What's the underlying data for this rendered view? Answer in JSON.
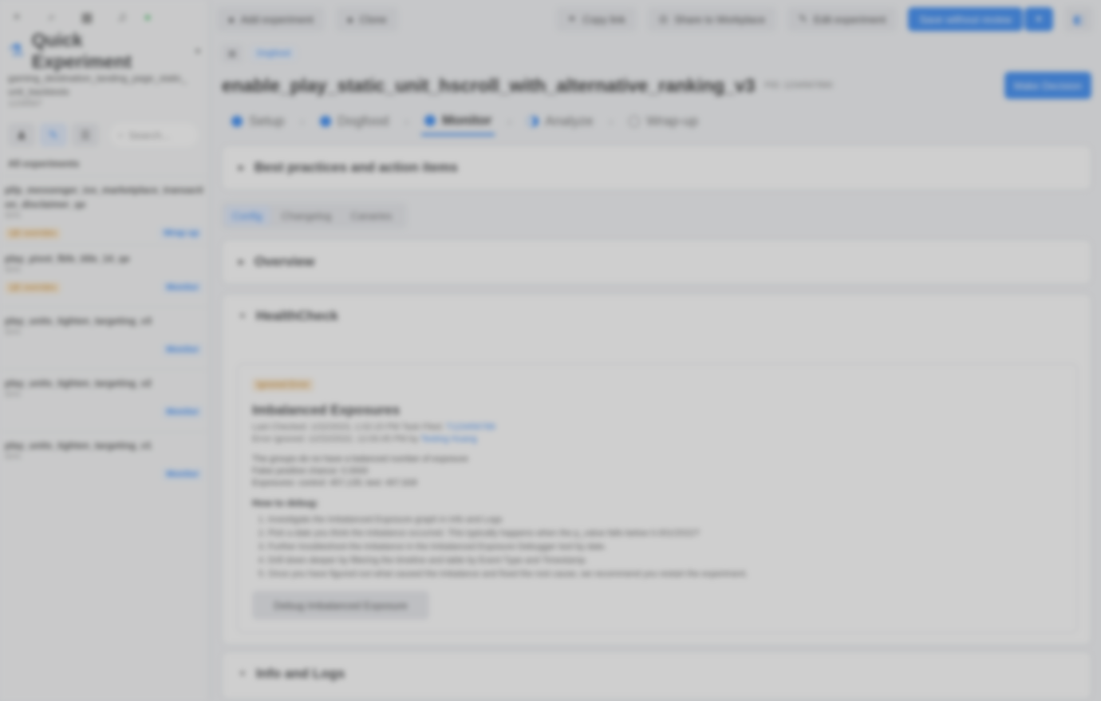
{
  "sidebar": {
    "app_title": "Quick Experiment",
    "experiment_name": "gaming_destination_landing_page_static_unit_backtests",
    "experiment_id": "1234567",
    "search_placeholder": "Search...",
    "all_label": "All experiments",
    "items": [
      {
        "name": "pl/p_messenger_ios_marketplace_transaction_disclaimer_qe",
        "pct": "50%",
        "badge": "QE overrides",
        "stage": "Wrap up"
      },
      {
        "name": "play_pivot_fbfe_title_14_qe",
        "pct": "50%",
        "badge": "QE overrides",
        "stage": "Monitor"
      },
      {
        "name": "play_units_tighten_targeting_v3",
        "pct": "50%",
        "badge": "",
        "stage": "Monitor"
      },
      {
        "name": "play_units_tighten_targeting_v2",
        "pct": "50%",
        "badge": "",
        "stage": "Monitor"
      },
      {
        "name": "play_units_tighten_targeting_v1",
        "pct": "50%",
        "badge": "",
        "stage": "Monitor"
      }
    ]
  },
  "toolbar": {
    "add_label": "Add experiment",
    "clone_label": "Clone",
    "copy_link_label": "Copy link",
    "share_label": "Share to Workplace",
    "edit_label": "Edit experiment",
    "save_label": "Save without review"
  },
  "breadcrumb": {
    "stage_chip": "Dogfood"
  },
  "header": {
    "title": "enable_play_static_unit_hscroll_with_alternative_ranking_v3",
    "fid": "FID: 1234567890",
    "decision_label": "Make Decision"
  },
  "stages": [
    "Setup",
    "Dogfood",
    "Monitor",
    "Analyze",
    "Wrap-up"
  ],
  "sections": {
    "best_practices": "Best practices and action items",
    "overview": "Overview",
    "healthcheck": "HealthCheck",
    "info_logs": "Info and Logs"
  },
  "tabs": [
    "Config",
    "Changelog",
    "Canaries"
  ],
  "health": {
    "badge": "Ignored Error",
    "title": "Imbalanced Exposures",
    "last_checked": "Last Checked: 1/22/2023, 1:02:15 PM Task Filed: ",
    "task_link": "T123456789",
    "ignored_by": "Error ignored: 12/22/2022, 12:00:45 PM by ",
    "ignored_user": "Testing Huang",
    "p1": "The groups do no have a balanced number of exposure",
    "p2": "False positive chance: 0.0000",
    "p3": "Exposures: control: 457,135; test: 457,928",
    "howto": "How to debug:",
    "steps": [
      "Investigate the Imbalanced Exposure graph in Info and Logs",
      "Pick a date you think the imbalance occurred. This typically happens when the p_value falls below 0.001/2022?",
      "Further troubleshoot the imbalance in the Imbalanced Exposure Debugger tool by date.",
      "Drill down deeper by filtering the timeline and table by Event Type and Timestamp.",
      "Once you have figured out what caused the imbalance and fixed the root cause, we recommend you restart the experiment."
    ],
    "debug_button": "Debug Imbalanced Exposure"
  }
}
